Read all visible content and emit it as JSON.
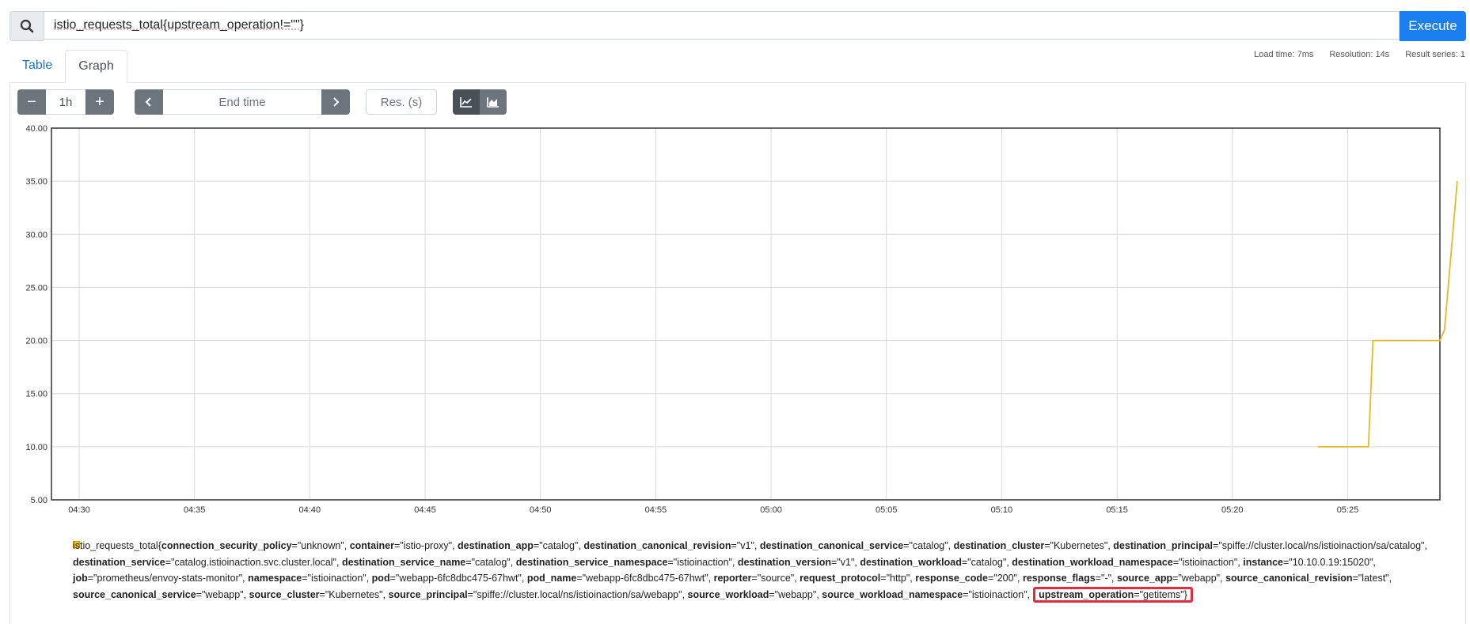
{
  "query": {
    "text": "istio_requests_total{upstream_operation!=\"\"}",
    "execute_label": "Execute"
  },
  "stats": {
    "load_time": "Load time: 7ms",
    "resolution": "Resolution: 14s",
    "result_series": "Result series: 1"
  },
  "tabs": [
    {
      "label": "Table"
    },
    {
      "label": "Graph"
    }
  ],
  "controls": {
    "minus": "−",
    "range": "1h",
    "plus": "+",
    "end_time_placeholder": "End time",
    "res_placeholder": "Res. (s)"
  },
  "chart_data": {
    "type": "line",
    "y_ticks": [
      "40.00",
      "35.00",
      "30.00",
      "25.00",
      "20.00",
      "15.00",
      "10.00",
      "5.00"
    ],
    "x_ticks": [
      "04:30",
      "04:35",
      "04:40",
      "04:45",
      "04:50",
      "04:55",
      "05:00",
      "05:05",
      "05:10",
      "05:15",
      "05:20",
      "05:25"
    ],
    "ylim": [
      5,
      40
    ],
    "x_minutes_range": [
      28.8,
      89.0
    ],
    "line_color": "#e8b923",
    "series": [
      {
        "x_minutes": [
          83.7,
          85.9,
          86.1,
          89.0,
          89.2,
          89.75
        ],
        "values": [
          10,
          10,
          20,
          20,
          21,
          35
        ]
      }
    ]
  },
  "legend": {
    "metric": "istio_requests_total{",
    "labels": [
      {
        "k": "connection_security_policy",
        "v": "=\"unknown\", "
      },
      {
        "k": "container",
        "v": "=\"istio-proxy\", "
      },
      {
        "k": "destination_app",
        "v": "=\"catalog\", "
      },
      {
        "k": "destination_canonical_revision",
        "v": "=\"v1\", "
      },
      {
        "k": "destination_canonical_service",
        "v": "=\"catalog\", "
      },
      {
        "k": "destination_cluster",
        "v": "=\"Kubernetes\", "
      },
      {
        "k": "destination_principal",
        "v": "=\"spiffe://cluster.local/ns/istioinaction/sa/catalog\", "
      },
      {
        "k": "destination_service",
        "v": "=\"catalog.istioinaction.svc.cluster.local\", "
      },
      {
        "k": "destination_service_name",
        "v": "=\"catalog\", "
      },
      {
        "k": "destination_service_namespace",
        "v": "=\"istioinaction\", "
      },
      {
        "k": "destination_version",
        "v": "=\"v1\", "
      },
      {
        "k": "destination_workload",
        "v": "=\"catalog\", "
      },
      {
        "k": "destination_workload_namespace",
        "v": "=\"istioinaction\", "
      },
      {
        "k": "instance",
        "v": "=\"10.10.0.19:15020\", "
      },
      {
        "k": "job",
        "v": "=\"prometheus/envoy-stats-monitor\", "
      },
      {
        "k": "namespace",
        "v": "=\"istioinaction\", "
      },
      {
        "k": "pod",
        "v": "=\"webapp-6fc8dbc475-67hwt\", "
      },
      {
        "k": "pod_name",
        "v": "=\"webapp-6fc8dbc475-67hwt\", "
      },
      {
        "k": "reporter",
        "v": "=\"source\", "
      },
      {
        "k": "request_protocol",
        "v": "=\"http\", "
      },
      {
        "k": "response_code",
        "v": "=\"200\", "
      },
      {
        "k": "response_flags",
        "v": "=\"-\", "
      },
      {
        "k": "source_app",
        "v": "=\"webapp\", "
      },
      {
        "k": "source_canonical_revision",
        "v": "=\"latest\", "
      },
      {
        "k": "source_canonical_service",
        "v": "=\"webapp\", "
      },
      {
        "k": "source_cluster",
        "v": "=\"Kubernetes\", "
      },
      {
        "k": "source_principal",
        "v": "=\"spiffe://cluster.local/ns/istioinaction/sa/webapp\", "
      },
      {
        "k": "source_workload",
        "v": "=\"webapp\", "
      },
      {
        "k": "source_workload_namespace",
        "v": "=\"istioinaction\","
      }
    ],
    "highlight_key": "upstream_operation",
    "highlight_val": "=\"getitems\"}"
  }
}
